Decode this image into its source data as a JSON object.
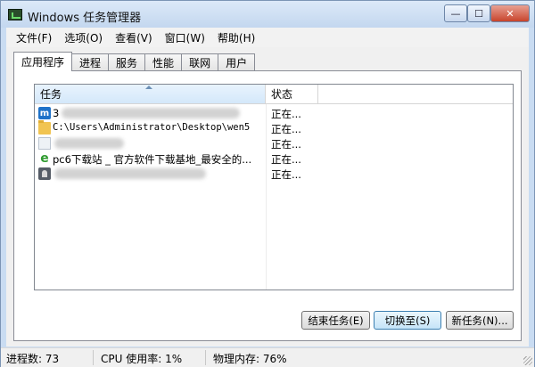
{
  "window": {
    "title": "Windows 任务管理器",
    "buttons": {
      "minimize": "—",
      "maximize": "☐",
      "close": "✕"
    }
  },
  "menu": [
    {
      "label": "文件(F)"
    },
    {
      "label": "选项(O)"
    },
    {
      "label": "查看(V)"
    },
    {
      "label": "窗口(W)"
    },
    {
      "label": "帮助(H)"
    }
  ],
  "tabs": [
    {
      "label": "应用程序",
      "active": true
    },
    {
      "label": "进程"
    },
    {
      "label": "服务"
    },
    {
      "label": "性能"
    },
    {
      "label": "联网"
    },
    {
      "label": "用户"
    }
  ],
  "list": {
    "columns": {
      "task": "任务",
      "status": "状态"
    },
    "rows": [
      {
        "icon": "maxthon-icon",
        "name": "3",
        "status": "正在..."
      },
      {
        "icon": "folder-icon",
        "name": "C:\\Users\\Administrator\\Desktop\\wen5",
        "status": "正在..."
      },
      {
        "icon": "document-icon",
        "name": "",
        "status": "正在..."
      },
      {
        "icon": "ie-icon",
        "name": "pc6下载站 _ 官方软件下载基地_最安全的...",
        "status": "正在..."
      },
      {
        "icon": "pen-icon",
        "name": "",
        "status": "正在..."
      }
    ]
  },
  "buttons": {
    "end_task": "结束任务(E)",
    "switch_to": "切换至(S)",
    "new_task": "新任务(N)..."
  },
  "statusbar": {
    "processes": "进程数: 73",
    "cpu": "CPU 使用率: 1%",
    "memory": "物理内存: 76%"
  },
  "colors": {
    "title_bg": "#c9dcf2",
    "close_button": "#c8442c",
    "header_highlight": "#d4e8fa",
    "focused_button": "#c5e4f8"
  }
}
